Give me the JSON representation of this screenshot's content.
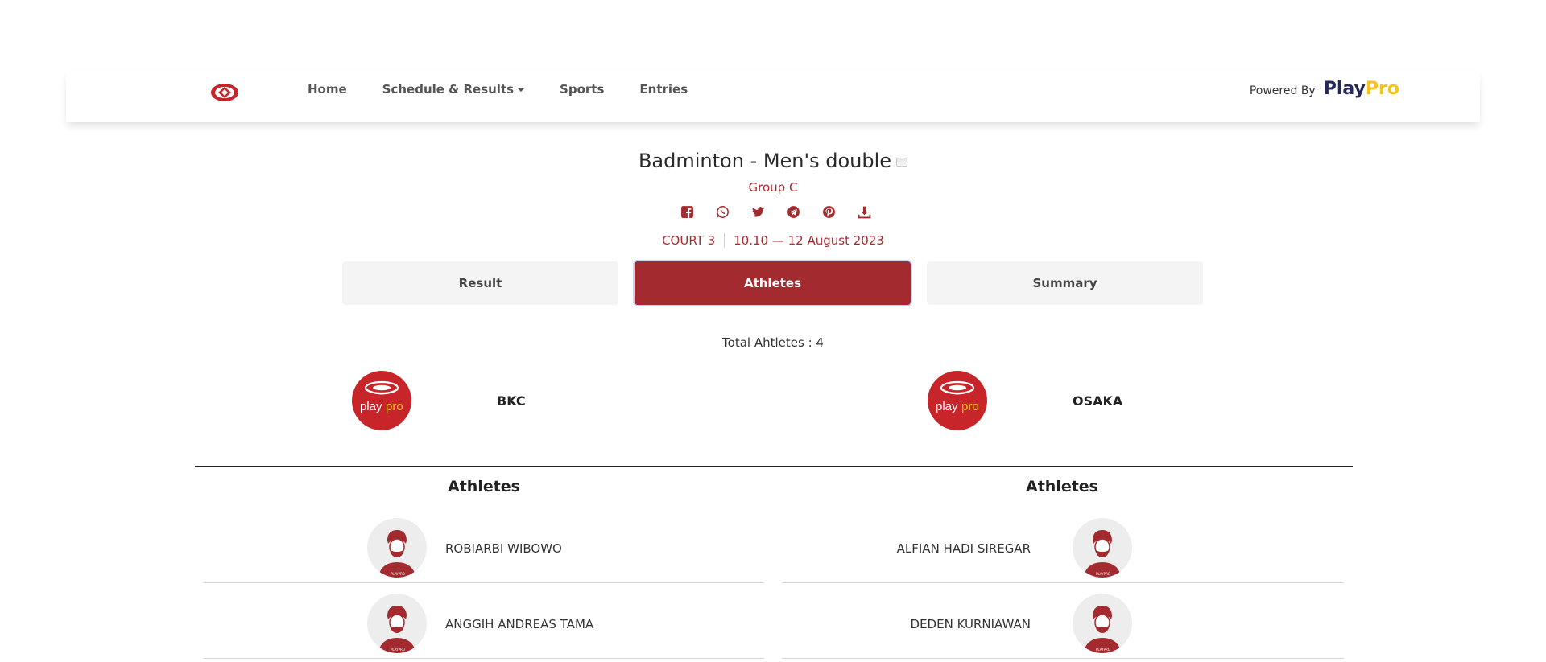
{
  "nav": {
    "links": [
      "Home",
      "Schedule & Results",
      "Sports",
      "Entries"
    ],
    "powered_label": "Powered By",
    "brand_a": "Play",
    "brand_b": "Pro"
  },
  "event": {
    "title": "Badminton - Men's double",
    "group": "Group C",
    "court": "COURT 3",
    "datetime": "10.10 — 12 August 2023"
  },
  "share_icons": [
    "facebook-icon",
    "whatsapp-icon",
    "twitter-icon",
    "telegram-icon",
    "pinterest-icon",
    "download-icon"
  ],
  "tabs": [
    {
      "label": "Result",
      "active": false
    },
    {
      "label": "Athletes",
      "active": true
    },
    {
      "label": "Summary",
      "active": false
    }
  ],
  "total_athletes": "Total Ahtletes : 4",
  "teams": {
    "left": {
      "name": "BKC",
      "logo_text_a": "play",
      "logo_text_b": "pro"
    },
    "right": {
      "name": "OSAKA",
      "logo_text_a": "play",
      "logo_text_b": "pro"
    }
  },
  "athletes": {
    "left_title": "Athletes",
    "right_title": "Athletes",
    "left": [
      "ROBIARBI WIBOWO",
      "ANGGIH ANDREAS TAMA"
    ],
    "right": [
      "ALFIAN HADI SIREGAR",
      "DEDEN KURNIAWAN"
    ],
    "avatar_caption": "PLAYPRO"
  },
  "colors": {
    "accent": "#a32a2e",
    "brand_dark": "#24295a",
    "brand_yellow": "#f7c41f"
  }
}
